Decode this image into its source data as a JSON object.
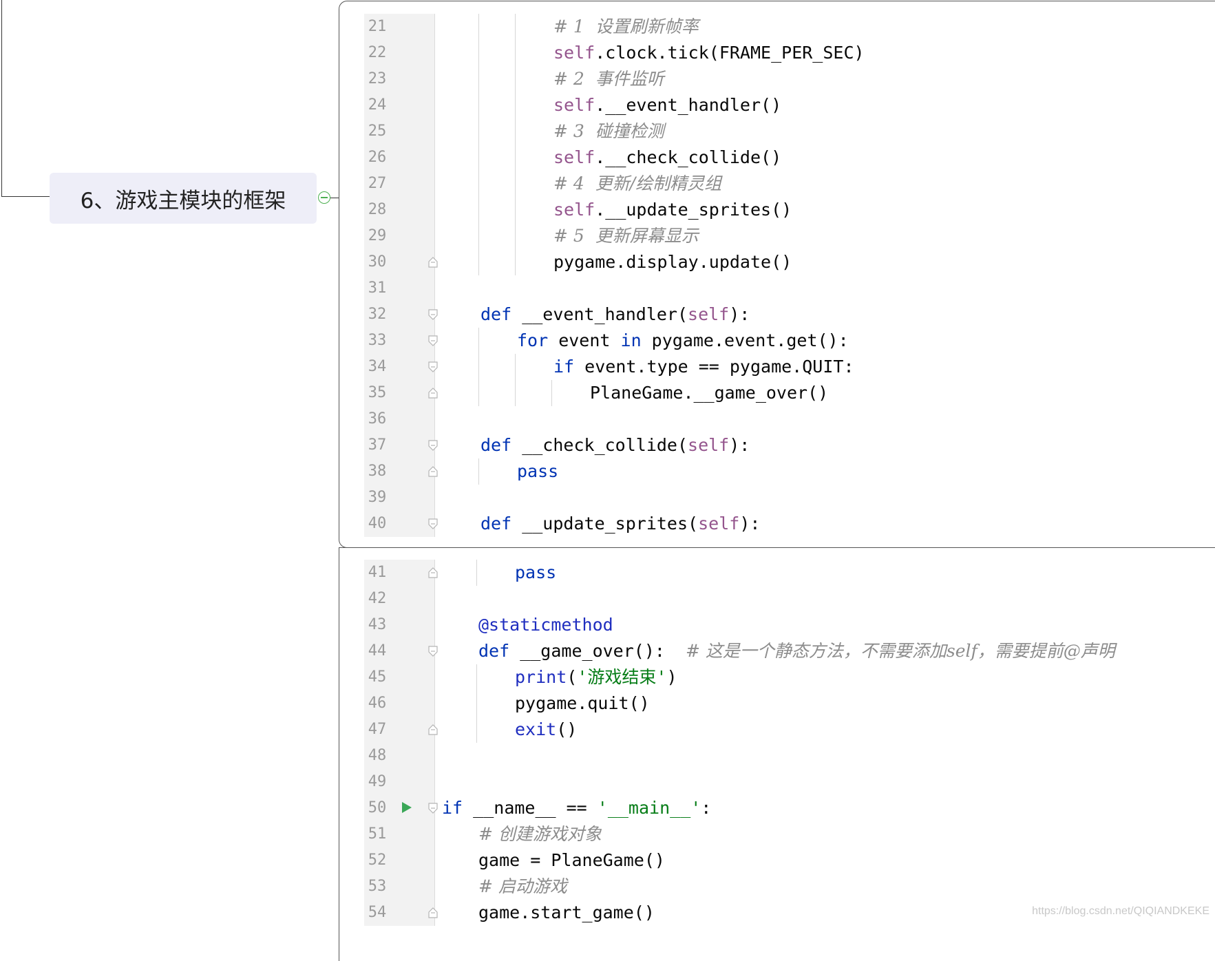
{
  "mindmap": {
    "node_label": "6、游戏主模块的框架"
  },
  "editor_top": {
    "lines": [
      {
        "n": "21",
        "indent": 3,
        "tokens": [
          [
            "cm",
            "# 1  设置刷新帧率"
          ]
        ]
      },
      {
        "n": "22",
        "indent": 3,
        "tokens": [
          [
            "self",
            "self"
          ],
          [
            "fn",
            ".clock.tick(FRAME_PER_SEC)"
          ]
        ]
      },
      {
        "n": "23",
        "indent": 3,
        "tokens": [
          [
            "cm",
            "# 2  事件监听"
          ]
        ]
      },
      {
        "n": "24",
        "indent": 3,
        "tokens": [
          [
            "self",
            "self"
          ],
          [
            "fn",
            ".__event_handler()"
          ]
        ]
      },
      {
        "n": "25",
        "indent": 3,
        "tokens": [
          [
            "cm",
            "# 3  碰撞检测"
          ]
        ]
      },
      {
        "n": "26",
        "indent": 3,
        "tokens": [
          [
            "self",
            "self"
          ],
          [
            "fn",
            ".__check_collide()"
          ]
        ]
      },
      {
        "n": "27",
        "indent": 3,
        "tokens": [
          [
            "cm",
            "# 4  更新/绘制精灵组"
          ]
        ]
      },
      {
        "n": "28",
        "indent": 3,
        "tokens": [
          [
            "self",
            "self"
          ],
          [
            "fn",
            ".__update_sprites()"
          ]
        ]
      },
      {
        "n": "29",
        "indent": 3,
        "tokens": [
          [
            "cm",
            "# 5  更新屏幕显示"
          ]
        ]
      },
      {
        "n": "30",
        "indent": 3,
        "fold": "end",
        "tokens": [
          [
            "fn",
            "pygame.display.update()"
          ]
        ]
      },
      {
        "n": "31",
        "indent": 0,
        "tokens": []
      },
      {
        "n": "32",
        "indent": 1,
        "fold": "start",
        "tokens": [
          [
            "kw",
            "def"
          ],
          [
            "fn",
            " __event_handler("
          ],
          [
            "self",
            "self"
          ],
          [
            "fn",
            "):"
          ]
        ]
      },
      {
        "n": "33",
        "indent": 2,
        "fold": "start",
        "tokens": [
          [
            "kw",
            "for"
          ],
          [
            "fn",
            " event "
          ],
          [
            "kw",
            "in"
          ],
          [
            "fn",
            " pygame.event.get():"
          ]
        ]
      },
      {
        "n": "34",
        "indent": 3,
        "fold": "start",
        "tokens": [
          [
            "kw",
            "if"
          ],
          [
            "fn",
            " event.type == pygame.QUIT:"
          ]
        ]
      },
      {
        "n": "35",
        "indent": 4,
        "fold": "end",
        "tokens": [
          [
            "fn",
            "PlaneGame.__game_over()"
          ]
        ]
      },
      {
        "n": "36",
        "indent": 0,
        "tokens": []
      },
      {
        "n": "37",
        "indent": 1,
        "fold": "start",
        "tokens": [
          [
            "kw",
            "def"
          ],
          [
            "fn",
            " __check_collide("
          ],
          [
            "self",
            "self"
          ],
          [
            "fn",
            "):"
          ]
        ]
      },
      {
        "n": "38",
        "indent": 2,
        "fold": "end",
        "tokens": [
          [
            "kw",
            "pass"
          ]
        ]
      },
      {
        "n": "39",
        "indent": 0,
        "tokens": []
      },
      {
        "n": "40",
        "indent": 1,
        "fold": "start",
        "tokens": [
          [
            "kw",
            "def"
          ],
          [
            "fn",
            " __update_sprites("
          ],
          [
            "self",
            "self"
          ],
          [
            "fn",
            "):"
          ]
        ]
      }
    ]
  },
  "editor_bottom": {
    "lines": [
      {
        "n": "41",
        "indent": 2,
        "fold": "end",
        "tokens": [
          [
            "kw",
            "pass"
          ]
        ]
      },
      {
        "n": "42",
        "indent": 0,
        "tokens": []
      },
      {
        "n": "43",
        "indent": 1,
        "tokens": [
          [
            "dec",
            "@staticmethod"
          ]
        ]
      },
      {
        "n": "44",
        "indent": 1,
        "fold": "start",
        "tokens": [
          [
            "kw",
            "def"
          ],
          [
            "fn",
            " __game_over():  "
          ],
          [
            "cm",
            "# 这是一个静态方法，不需要添加self，需要提前@声明"
          ]
        ]
      },
      {
        "n": "45",
        "indent": 2,
        "tokens": [
          [
            "dec",
            "print"
          ],
          [
            "fn",
            "("
          ],
          [
            "str",
            "'游戏结束'"
          ],
          [
            "fn",
            ")"
          ]
        ]
      },
      {
        "n": "46",
        "indent": 2,
        "tokens": [
          [
            "fn",
            "pygame.quit()"
          ]
        ]
      },
      {
        "n": "47",
        "indent": 2,
        "fold": "end",
        "tokens": [
          [
            "dec",
            "exit"
          ],
          [
            "fn",
            "()"
          ]
        ]
      },
      {
        "n": "48",
        "indent": 0,
        "tokens": []
      },
      {
        "n": "49",
        "indent": 0,
        "tokens": []
      },
      {
        "n": "50",
        "indent": 0,
        "fold": "start",
        "run": true,
        "tokens": [
          [
            "kw",
            "if"
          ],
          [
            "fn",
            " __name__ == "
          ],
          [
            "str",
            "'__main__'"
          ],
          [
            "fn",
            ":"
          ]
        ]
      },
      {
        "n": "51",
        "indent": 1,
        "tokens": [
          [
            "cm",
            "# 创建游戏对象"
          ]
        ]
      },
      {
        "n": "52",
        "indent": 1,
        "tokens": [
          [
            "fn",
            "game = PlaneGame()"
          ]
        ]
      },
      {
        "n": "53",
        "indent": 1,
        "tokens": [
          [
            "cm",
            "# 启动游戏"
          ]
        ]
      },
      {
        "n": "54",
        "indent": 1,
        "fold": "end",
        "tokens": [
          [
            "fn",
            "game.start_game()"
          ]
        ]
      }
    ]
  },
  "watermark": "https://blog.csdn.net/QIQIANDKEKE"
}
